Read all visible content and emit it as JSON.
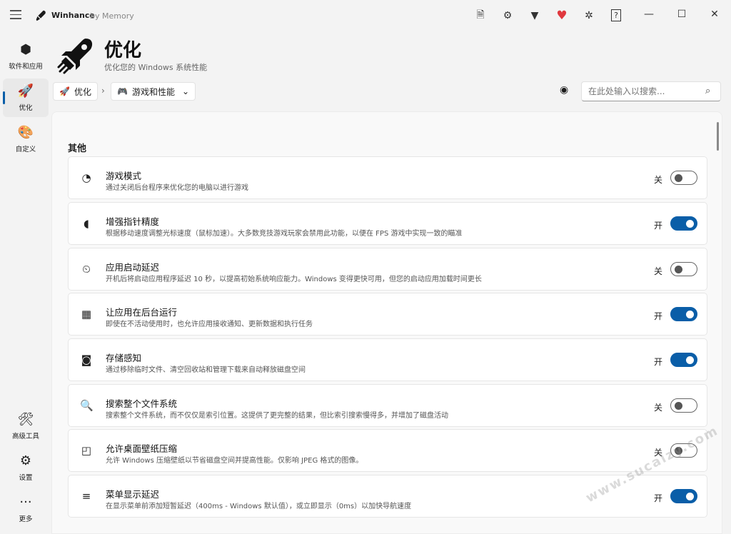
{
  "app": {
    "name": "Winhance",
    "by": "by Memory"
  },
  "titlebar_icons": [
    {
      "name": "import-config-icon",
      "glyph": "🗎"
    },
    {
      "name": "export-config-icon",
      "glyph": "⚙"
    },
    {
      "name": "filter-icon",
      "glyph": "▼"
    },
    {
      "name": "donate-heart-icon",
      "glyph": "♥"
    },
    {
      "name": "bug-report-icon",
      "glyph": "✲"
    },
    {
      "name": "help-icon",
      "glyph": "?"
    }
  ],
  "window_controls": {
    "minimize": "—",
    "maximize": "☐",
    "close": "✕"
  },
  "sidebar": {
    "items": [
      {
        "label": "软件和应用",
        "icon": "box-icon",
        "glyph": "⬢"
      },
      {
        "label": "优化",
        "icon": "rocket-icon",
        "glyph": "🚀"
      },
      {
        "label": "自定义",
        "icon": "palette-icon",
        "glyph": "🎨"
      },
      {
        "label": "高级工具",
        "icon": "tools-icon",
        "glyph": "🛠"
      },
      {
        "label": "设置",
        "icon": "gear-icon",
        "glyph": "⚙"
      },
      {
        "label": "更多",
        "icon": "more-icon",
        "glyph": "···"
      }
    ]
  },
  "header": {
    "title": "优化",
    "subtitle": "优化您的 Windows 系统性能"
  },
  "breadcrumb": {
    "root": "优化",
    "current": "游戏和性能"
  },
  "search": {
    "placeholder": "在此处输入以搜索..."
  },
  "section": {
    "title": "其他"
  },
  "settings": [
    {
      "title": "游戏模式",
      "desc": "通过关闭后台程序来优化您的电脑以进行游戏",
      "state": "关",
      "on": false,
      "glyph": "◔",
      "icon": "gauge-icon"
    },
    {
      "title": "增强指针精度",
      "desc": "根据移动速度调整光标速度（鼠标加速）。大多数竞技游戏玩家会禁用此功能，以便在 FPS 游戏中实现一致的瞄准",
      "state": "开",
      "on": true,
      "glyph": "◖",
      "icon": "mouse-icon"
    },
    {
      "title": "应用启动延迟",
      "desc": "开机后将启动应用程序延迟 10 秒，以提高初始系统响应能力。Windows 变得更快可用，但您的启动应用加载时间更长",
      "state": "关",
      "on": false,
      "glyph": "⏲",
      "icon": "timer-icon"
    },
    {
      "title": "让应用在后台运行",
      "desc": "即使在不活动使用时，也允许应用接收通知、更新数据和执行任务",
      "state": "开",
      "on": true,
      "glyph": "▦",
      "icon": "apps-grid-icon"
    },
    {
      "title": "存储感知",
      "desc": "通过移除临时文件、清空回收站和管理下载来自动释放磁盘空间",
      "state": "开",
      "on": true,
      "glyph": "◙",
      "icon": "disk-icon"
    },
    {
      "title": "搜索整个文件系统",
      "desc": "搜索整个文件系统，而不仅仅是索引位置。这提供了更完整的结果，但比索引搜索慢得多，并增加了磁盘活动",
      "state": "关",
      "on": false,
      "glyph": "🔍",
      "icon": "folder-search-icon"
    },
    {
      "title": "允许桌面壁纸压缩",
      "desc": "允许 Windows 压缩壁纸以节省磁盘空间并提高性能。仅影响 JPEG 格式的图像。",
      "state": "关",
      "on": false,
      "glyph": "◰",
      "icon": "image-compress-icon"
    },
    {
      "title": "菜单显示延迟",
      "desc": "在显示菜单前添加短暂延迟（400ms - Windows 默认值），或立即显示（0ms）以加快导航速度",
      "state": "开",
      "on": true,
      "glyph": "≡",
      "icon": "menu-delay-icon"
    }
  ],
  "watermark": "www.sucaizy.com"
}
